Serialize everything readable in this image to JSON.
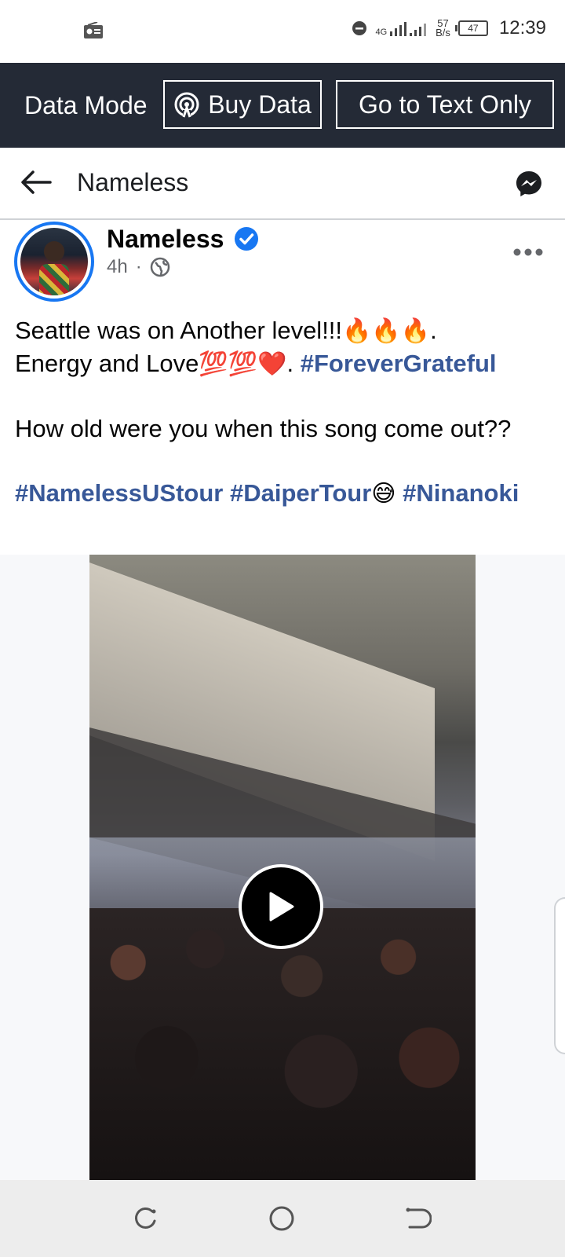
{
  "status_bar": {
    "network_speed_value": "57",
    "network_speed_unit": "B/s",
    "network_type": "4G",
    "battery": "47",
    "time": "12:39",
    "icons": [
      "radio-icon",
      "dnd-icon",
      "signal-icon",
      "wifi-icon",
      "battery-icon"
    ]
  },
  "data_bar": {
    "mode_label": "Data Mode",
    "buy_data_label": "Buy Data",
    "text_only_label": "Go to Text Only"
  },
  "header": {
    "title": "Nameless",
    "icons": [
      "back-arrow-icon",
      "messenger-icon"
    ]
  },
  "post": {
    "author": "Nameless",
    "time_ago": "4h",
    "separator": "·",
    "audience_icon": "globe-icon",
    "text": {
      "line1_prefix": "Seattle was on Another level!!!",
      "line1_emojis": "🔥🔥🔥",
      "line1_suffix": ".",
      "line2_prefix": "Energy and Love",
      "line2_emojis": "💯💯❤️",
      "line2_mid": ". ",
      "hashtag1": "#ForeverGrateful",
      "question": "How old were you when this song come out??",
      "hashtag2": "#NamelessUStour",
      "hashtag3": "#DaiperTour",
      "hashtag3_emoji": "😅",
      "hashtag4": "#Ninanoki"
    },
    "video": {
      "play_icon": "play-icon"
    }
  },
  "nav_bar": {
    "icons": [
      "recents-icon",
      "home-icon",
      "back-icon"
    ]
  },
  "colors": {
    "data_bar_bg": "#242a36",
    "hashtag": "#385898",
    "verified": "#1877f2",
    "nav_bg": "#ededed"
  }
}
